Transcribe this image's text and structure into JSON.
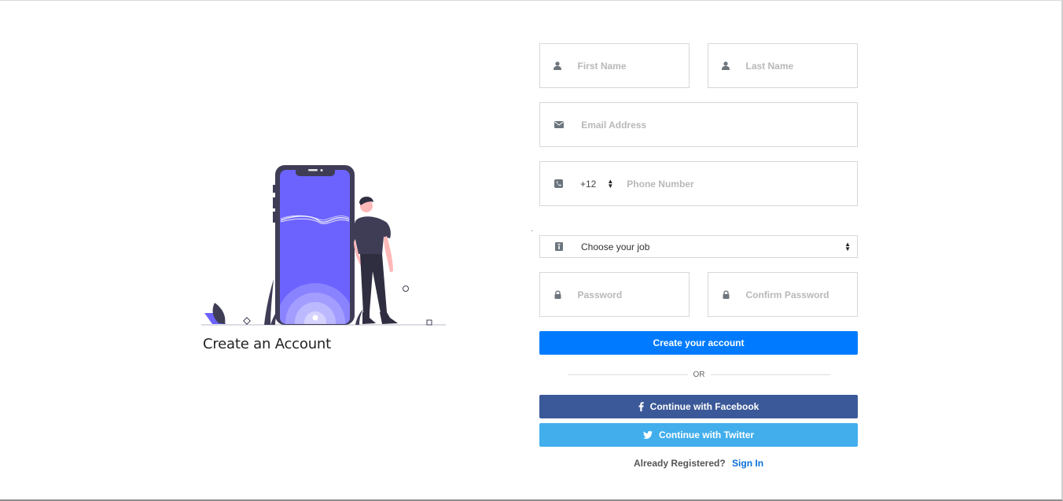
{
  "page": {
    "title": "Create an Account"
  },
  "form": {
    "first_name": {
      "placeholder": "First Name",
      "icon": "user-icon"
    },
    "last_name": {
      "placeholder": "Last Name",
      "icon": "user-icon"
    },
    "email": {
      "placeholder": "Email Address",
      "icon": "envelope-icon"
    },
    "phone": {
      "placeholder": "Phone Number",
      "icon": "phone-icon",
      "country_code": "+12"
    },
    "job": {
      "selected": "Choose your job",
      "icon": "id-badge-icon"
    },
    "password": {
      "placeholder": "Password",
      "icon": "lock-icon"
    },
    "confirm_password": {
      "placeholder": "Confirm Password",
      "icon": "lock-icon"
    },
    "create_label": "Create your account",
    "or_label": "OR",
    "facebook_label": "Continue with Facebook",
    "twitter_label": "Continue with Twitter",
    "already_text": "Already Registered?",
    "signin_label": "Sign In"
  },
  "colors": {
    "primary": "#007bff",
    "facebook": "#3b5998",
    "twitter": "#42aeec",
    "illustration_accent": "#6c63ff",
    "illustration_dark": "#3f3d56"
  }
}
